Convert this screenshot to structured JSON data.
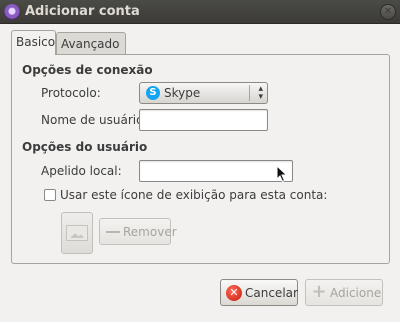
{
  "window": {
    "title": "Adicionar conta",
    "close_glyph": "✕"
  },
  "tabs": [
    {
      "label": "Basico",
      "active": true
    },
    {
      "label": "Avançado",
      "active": false
    }
  ],
  "connection": {
    "heading": "Opções de conexão",
    "protocol_label": "Protocolo:",
    "protocol_value": "Skype",
    "protocol_icon": "skype-icon",
    "username_label": "Nome de usuário:",
    "username_value": ""
  },
  "user": {
    "heading": "Opções do usuário",
    "alias_label": "Apelido local:",
    "alias_value": "",
    "icon_checkbox_label": "Usar este ícone de exibição para esta conta:",
    "icon_checkbox_checked": false,
    "remove_label": "Remover"
  },
  "footer": {
    "cancel_label": "Cancelar",
    "add_label": "Adicione"
  }
}
